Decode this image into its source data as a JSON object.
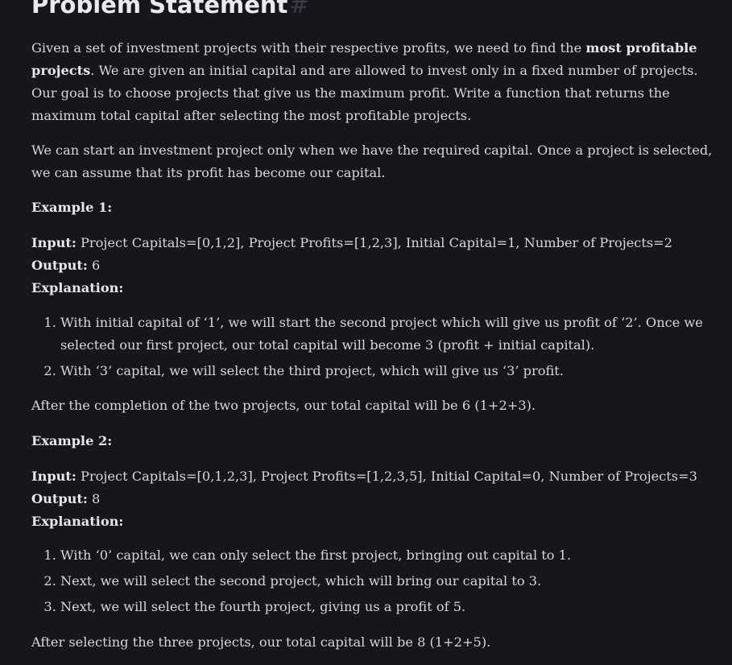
{
  "heading": {
    "title": "Problem Statement",
    "anchor": "#"
  },
  "intro": {
    "p1_before": "Given a set of investment projects with their respective profits, we need to find the ",
    "p1_bold": "most profitable projects",
    "p1_after": ". We are given an initial capital and are allowed to invest only in a fixed number of projects. Our goal is to choose projects that give us the maximum profit. Write a function that returns the maximum total capital after selecting the most profitable projects.",
    "p2": "We can start an investment project only when we have the required capital. Once a project is selected, we can assume that its profit has become our capital."
  },
  "example1": {
    "title": "Example 1:",
    "input_label": "Input:",
    "input_value": " Project Capitals=[0,1,2], Project Profits=[1,2,3], Initial Capital=1, Number of Projects=2",
    "output_label": "Output:",
    "output_value": " 6",
    "explanation_label": "Explanation:",
    "steps": [
      "With initial capital of ‘1’, we will start the second project which will give us profit of ‘2’. Once we selected our first project, our total capital will become 3 (profit + initial capital).",
      "With ‘3’ capital, we will select the third project, which will give us ‘3’ profit."
    ],
    "conclusion": "After the completion of the two projects, our total capital will be 6 (1+2+3)."
  },
  "example2": {
    "title": "Example 2:",
    "input_label": "Input:",
    "input_value": " Project Capitals=[0,1,2,3], Project Profits=[1,2,3,5], Initial Capital=0, Number of Projects=3",
    "output_label": "Output:",
    "output_value": " 8",
    "explanation_label": "Explanation:",
    "steps": [
      "With ‘0’ capital, we can only select the first project, bringing out capital to 1.",
      "Next, we will select the second project, which will bring our capital to 3.",
      "Next, we will select the fourth project, giving us a profit of 5."
    ],
    "conclusion": "After selecting the three projects, our total capital will be 8 (1+2+5)."
  }
}
